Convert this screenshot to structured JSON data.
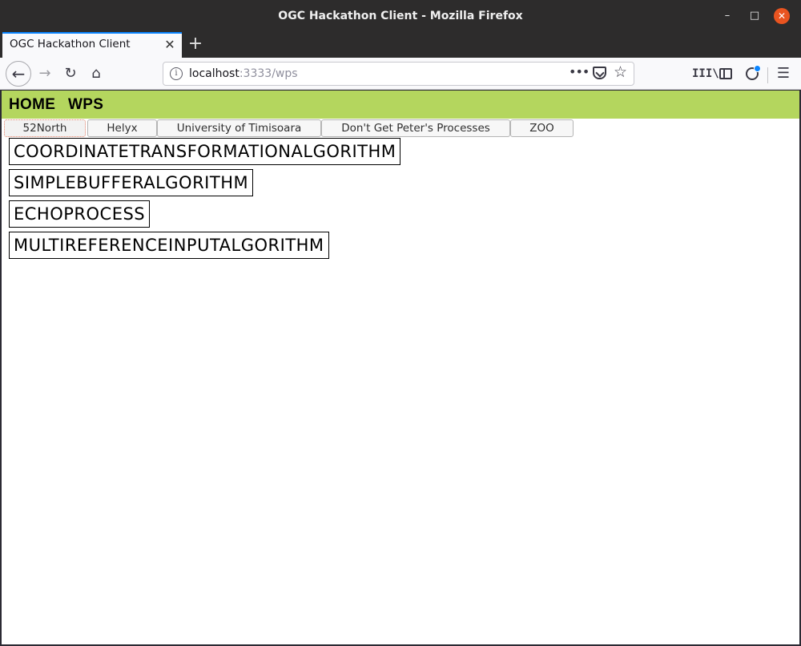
{
  "window": {
    "title": "OGC Hackathon Client - Mozilla Firefox",
    "minimize": "–",
    "maximize": "□",
    "close": "✕"
  },
  "browser": {
    "tab_title": "OGC Hackathon Client",
    "tab_close": "✕",
    "new_tab": "+",
    "url_host": "localhost",
    "url_rest": ":3333/wps",
    "page_actions": "•••",
    "library": "III\\",
    "menu": "☰",
    "icons": {
      "back": "back-arrow-icon",
      "forward": "forward-arrow-icon",
      "reload": "reload-icon",
      "home": "home-icon",
      "info": "info-icon",
      "pocket": "pocket-icon",
      "bookmark": "star-icon",
      "sidebar": "sidebar-icon",
      "account": "account-icon"
    }
  },
  "app": {
    "nav": {
      "home": "HOME",
      "wps": "WPS"
    },
    "accent_color": "#b4d65e",
    "providers": [
      "52North",
      "Helyx",
      "University of Timisoara",
      "Don't Get Peter's Processes",
      "ZOO"
    ],
    "selected_provider": "52North",
    "processes": [
      "COORDINATETRANSFORMATIONALGORITHM",
      "SIMPLEBUFFERALGORITHM",
      "ECHOPROCESS",
      "MULTIREFERENCEINPUTALGORITHM"
    ]
  }
}
